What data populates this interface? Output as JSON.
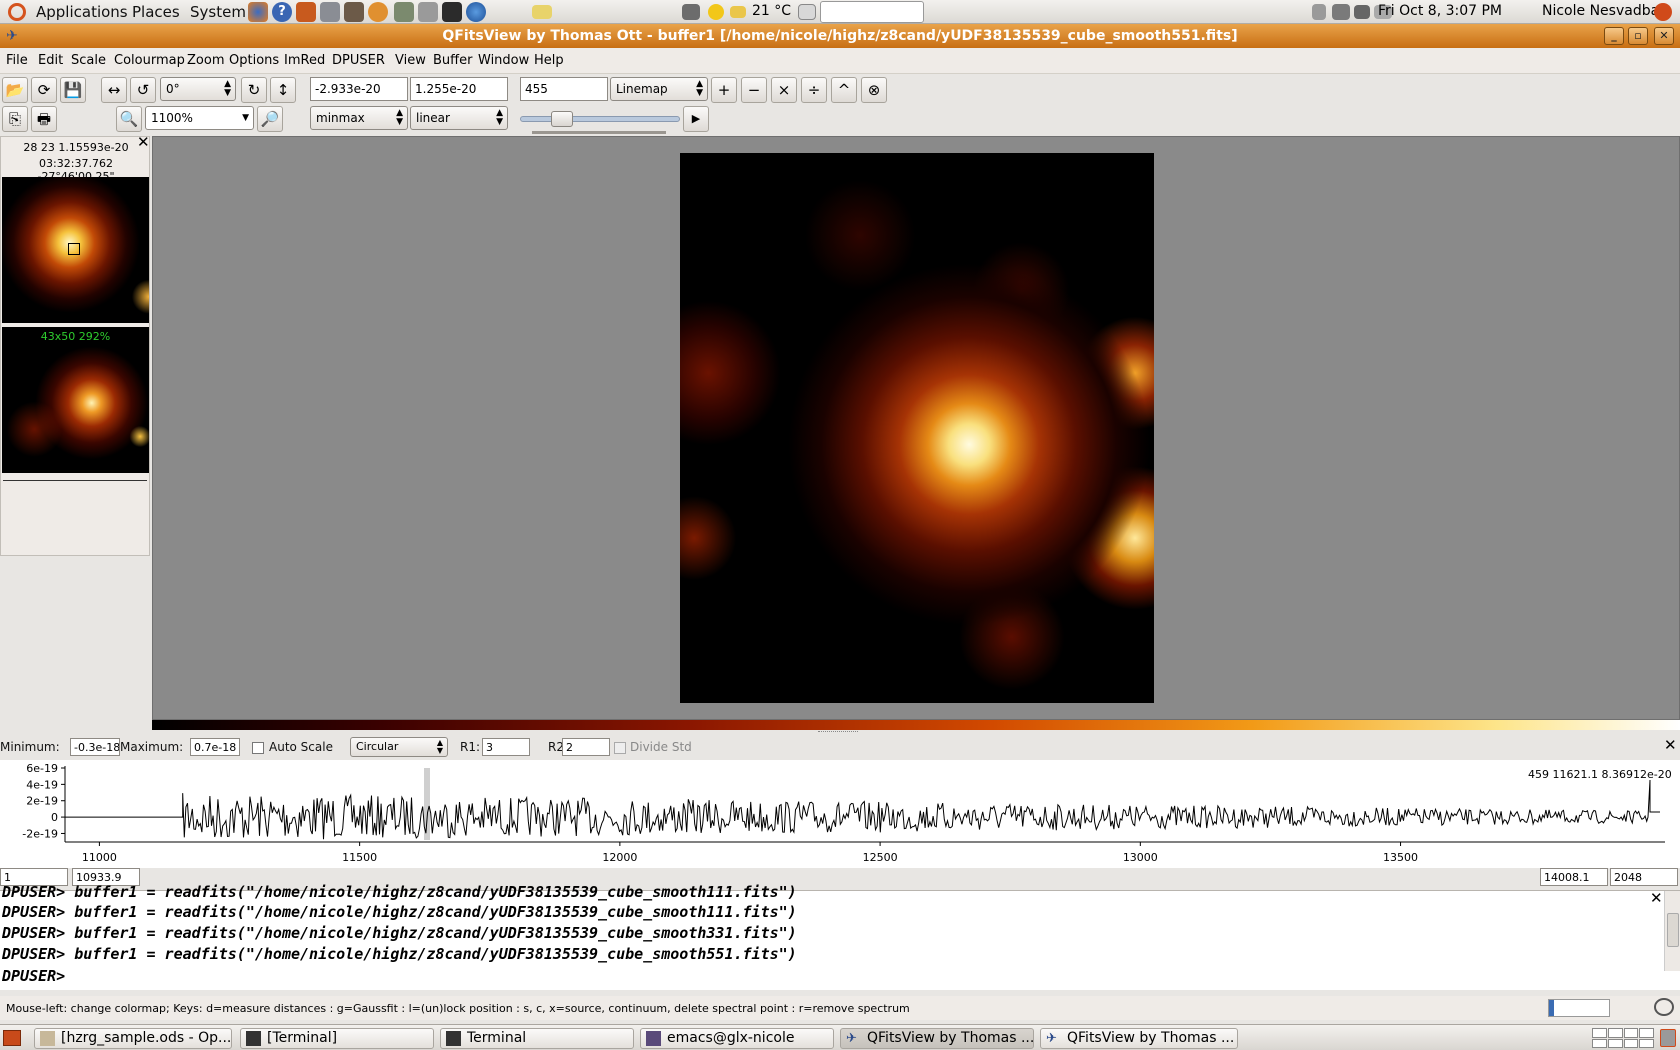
{
  "top_panel": {
    "menus": [
      "Applications",
      "Places",
      "System"
    ],
    "weather": "21 °C",
    "clock": "Fri Oct  8,  3:07 PM",
    "user": "Nicole Nesvadba"
  },
  "window": {
    "title": "QFitsView by Thomas Ott - buffer1 [/home/nicole/highz/z8cand/yUDF38135539_cube_smooth551.fits]"
  },
  "menubar": [
    "File",
    "Edit",
    "Scale",
    "Colourmap",
    "Zoom",
    "Options",
    "ImRed",
    "DPUSER",
    "View",
    "Buffer",
    "Window",
    "Help"
  ],
  "toolbar": {
    "rotation": "0°",
    "min_value": "-2.933e-20",
    "max_value": "1.255e-20",
    "slice": "455",
    "mode": "Linemap",
    "zoom": "1100%",
    "scale_method": "minmax",
    "scale_type": "linear",
    "ops": [
      "+",
      "−",
      "×",
      "÷",
      "^",
      "⊗"
    ]
  },
  "left_panel": {
    "pixel_info": "28 23 1.15593e-20",
    "coords": "03:32:37.762 -27°46'00.25\"",
    "overview_label": "43x50  292%"
  },
  "cube_controls": {
    "min_label": "Minimum:",
    "min_value": "-0.3e-18",
    "max_label": "Maximum:",
    "max_value": "0.7e-18",
    "auto_scale": "Auto Scale",
    "aperture": "Circular",
    "r1_label": "R1:",
    "r1": "3",
    "r2_label": "R2:",
    "r2": "2",
    "divide_std": "Divide Std"
  },
  "spectrum": {
    "readout": "459 11621.1 8.36912e-20",
    "y_ticks": [
      "6e-19",
      "4e-19",
      "2e-19",
      "0",
      "-2e-19"
    ],
    "x_ticks": [
      "11000",
      "11500",
      "12000",
      "12500",
      "13000",
      "13500"
    ],
    "range_start_index": "1",
    "range_start": "10933.9",
    "range_end": "14008.1",
    "range_end_index": "2048"
  },
  "console": {
    "lines": [
      "DPUSER> buffer1 = readfits(\"/home/nicole/highz/z8cand/yUDF38135539_cube_smooth111.fits\")",
      "DPUSER> buffer1 = readfits(\"/home/nicole/highz/z8cand/yUDF38135539_cube_smooth111.fits\")",
      "DPUSER> buffer1 = readfits(\"/home/nicole/highz/z8cand/yUDF38135539_cube_smooth331.fits\")",
      "DPUSER> buffer1 = readfits(\"/home/nicole/highz/z8cand/yUDF38135539_cube_smooth551.fits\")"
    ],
    "prompt": "DPUSER>"
  },
  "status": "Mouse-left: change colormap; Keys: d=measure distances : g=Gaussfit : l=(un)lock position : s, c, x=source, continuum, delete spectral point : r=remove spectrum",
  "taskbar": [
    {
      "label": "[hzrg_sample.ods - Op...",
      "active": false
    },
    {
      "label": "[Terminal]",
      "active": false
    },
    {
      "label": "Terminal",
      "active": false
    },
    {
      "label": "emacs@glx-nicole",
      "active": false
    },
    {
      "label": "QFitsView by Thomas ...",
      "active": true
    },
    {
      "label": "QFitsView by Thomas ...",
      "active": false
    }
  ]
}
